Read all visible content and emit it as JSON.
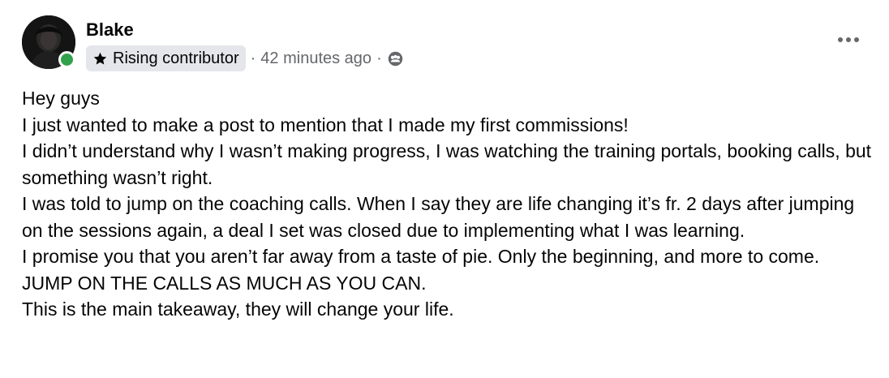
{
  "post": {
    "author": "Blake",
    "badge": {
      "icon": "star-icon",
      "label": "Rising contributor"
    },
    "separator": "·",
    "timestamp": "42 minutes ago",
    "audience_icon": "group-icon",
    "more_icon": "more-options-icon",
    "online": true,
    "paragraphs": [
      "Hey guys",
      "I just wanted to make a post to mention that I made my first commissions!",
      "I didn’t understand why I wasn’t making progress, I was watching the training portals, booking calls, but something wasn’t right.",
      "I was told to jump on the coaching calls. When I say they are life changing it’s fr. 2 days after jumping on the sessions again, a deal I set was closed due to implementing what I was learning.",
      "I promise you that you aren’t far away from a taste of pie. Only the beginning, and more to come.",
      "JUMP ON THE CALLS AS MUCH AS YOU CAN.",
      "This is the main takeaway, they will change your life."
    ]
  },
  "colors": {
    "text": "#050505",
    "secondary_text": "#65676b",
    "badge_bg": "#e4e6eb",
    "online_dot": "#31a24c"
  }
}
